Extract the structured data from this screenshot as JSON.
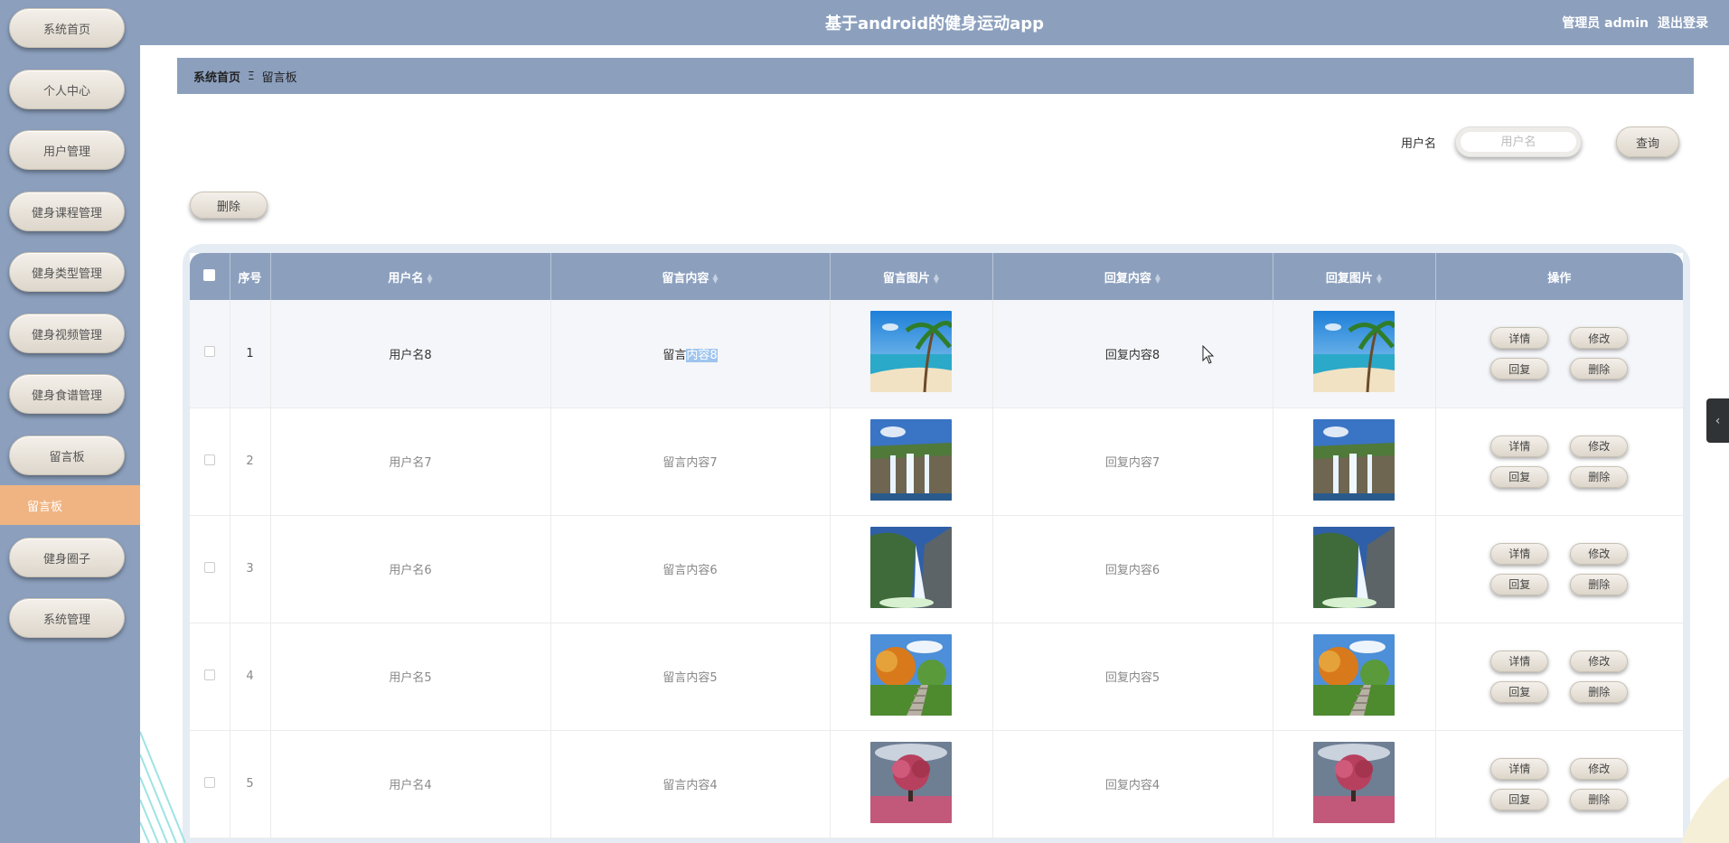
{
  "app": {
    "title": "基于android的健身运动app",
    "user": "管理员 admin",
    "logout": "退出登录"
  },
  "colors": {
    "primary": "#8ca0be",
    "active_nav": "#f0b482",
    "button_bg": "#ebe5dc"
  },
  "sidebar": {
    "items": [
      {
        "label": "系统首页"
      },
      {
        "label": "个人中心"
      },
      {
        "label": "用户管理"
      },
      {
        "label": "健身课程管理"
      },
      {
        "label": "健身类型管理"
      },
      {
        "label": "健身视频管理"
      },
      {
        "label": "健身食谱管理"
      },
      {
        "label": "留言板"
      },
      {
        "label": "健身圈子"
      },
      {
        "label": "系统管理"
      }
    ],
    "active_sub": "留言板"
  },
  "breadcrumb": {
    "home": "系统首页",
    "separator": "Ξ",
    "current": "留言板"
  },
  "search": {
    "label": "用户名",
    "placeholder": "用户名",
    "value": "",
    "query_button": "查询"
  },
  "toolbar": {
    "delete_button": "删除"
  },
  "table": {
    "columns": [
      "序号",
      "用户名",
      "留言内容",
      "留言图片",
      "回复内容",
      "回复图片",
      "操作"
    ],
    "sortable": [
      false,
      true,
      true,
      true,
      true,
      true,
      false
    ],
    "rows": [
      {
        "index": "1",
        "username": "用户名8",
        "message_prefix": "留言",
        "message_highlight": "内容8",
        "image": "beach",
        "reply": "回复内容8",
        "reply_image": "beach"
      },
      {
        "index": "2",
        "username": "用户名7",
        "message": "留言内容7",
        "image": "waterfall-cliff",
        "reply": "回复内容7",
        "reply_image": "waterfall-cliff"
      },
      {
        "index": "3",
        "username": "用户名6",
        "message": "留言内容6",
        "image": "waterfall-mountain",
        "reply": "回复内容6",
        "reply_image": "waterfall-mountain"
      },
      {
        "index": "4",
        "username": "用户名5",
        "message": "留言内容5",
        "image": "autumn-stairs",
        "reply": "回复内容5",
        "reply_image": "autumn-stairs"
      },
      {
        "index": "5",
        "username": "用户名4",
        "message": "留言内容4",
        "image": "pink-tree",
        "reply": "回复内容4",
        "reply_image": "pink-tree"
      }
    ],
    "actions": {
      "detail": "详情",
      "edit": "修改",
      "reply": "回复",
      "delete": "删除"
    }
  }
}
